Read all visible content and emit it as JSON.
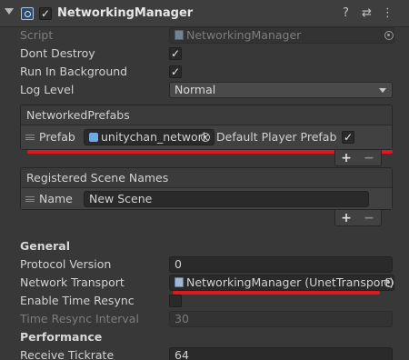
{
  "header": {
    "title": "NetworkingManager",
    "enabled_mark": "✓",
    "help_glyph": "?",
    "preset_glyph": "⇄",
    "menu_glyph": "⋮"
  },
  "fields": {
    "script_label": "Script",
    "script_value": "NetworkingManager",
    "dont_destroy_label": "Dont Destroy",
    "dont_destroy_mark": "✓",
    "run_bg_label": "Run In Background",
    "run_bg_mark": "✓",
    "log_level_label": "Log Level",
    "log_level_value": "Normal"
  },
  "networked_prefabs": {
    "header": "NetworkedPrefabs",
    "prefab_label": "Prefab",
    "prefab_value": "unitychan_network",
    "default_player_label": "Default Player Prefab",
    "default_player_mark": "✓",
    "plus": "+",
    "minus": "−"
  },
  "scene_names": {
    "header": "Registered Scene Names",
    "name_label": "Name",
    "name_value": "New Scene",
    "plus": "+",
    "minus": "−"
  },
  "general": {
    "section_label": "General",
    "protocol_label": "Protocol Version",
    "protocol_value": "0",
    "transport_label": "Network Transport",
    "transport_value": "NetworkingManager (UnetTransport)",
    "time_resync_label": "Enable Time Resync",
    "resync_interval_label": "Time Resync Interval",
    "resync_interval_value": "30"
  },
  "performance": {
    "section_label": "Performance",
    "receive_tickrate_label": "Receive Tickrate",
    "receive_tickrate_value": "64"
  },
  "colors": {
    "background": "#383838",
    "highlight": "#e0171f",
    "field": "#2a2a2a"
  }
}
